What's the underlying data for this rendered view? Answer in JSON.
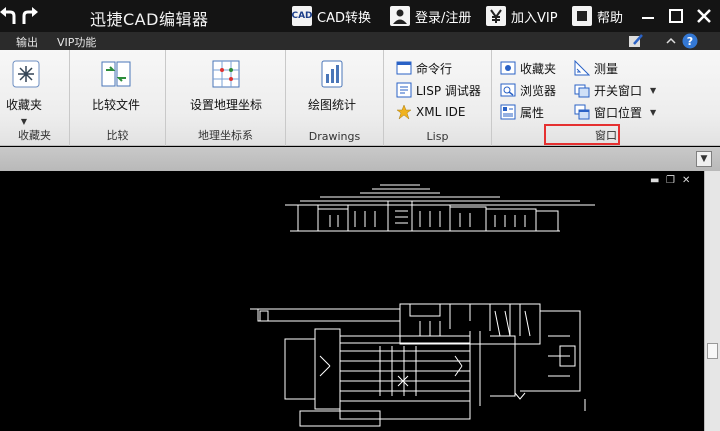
{
  "titlebar": {
    "app_title": "迅捷CAD编辑器",
    "cad_convert": "CAD转换",
    "cad_icon_text": "CAD",
    "login": "登录/注册",
    "vip": "加入VIP",
    "help": "帮助"
  },
  "tabs": [
    {
      "label": "输出"
    },
    {
      "label": "VIP功能"
    }
  ],
  "ribbon": {
    "groups": [
      {
        "label": "收藏夹",
        "button": "收藏夹"
      },
      {
        "label": "比较",
        "button": "比较文件"
      },
      {
        "label": "地理坐标系",
        "button": "设置地理坐标"
      },
      {
        "label": "Drawings",
        "button": "绘图统计"
      },
      {
        "label": "Lisp",
        "items": [
          "命令行",
          "LISP 调试器",
          "XML IDE"
        ]
      },
      {
        "label": "窗口",
        "items": [
          "收藏夹",
          "浏览器",
          "属性",
          "测量",
          "开关窗口",
          "窗口位置"
        ]
      }
    ]
  },
  "colors": {
    "titlebar_bg": "#141414",
    "ribbon_bg": "#ededed",
    "canvas_bg": "#000000",
    "highlight": "#e53030"
  }
}
